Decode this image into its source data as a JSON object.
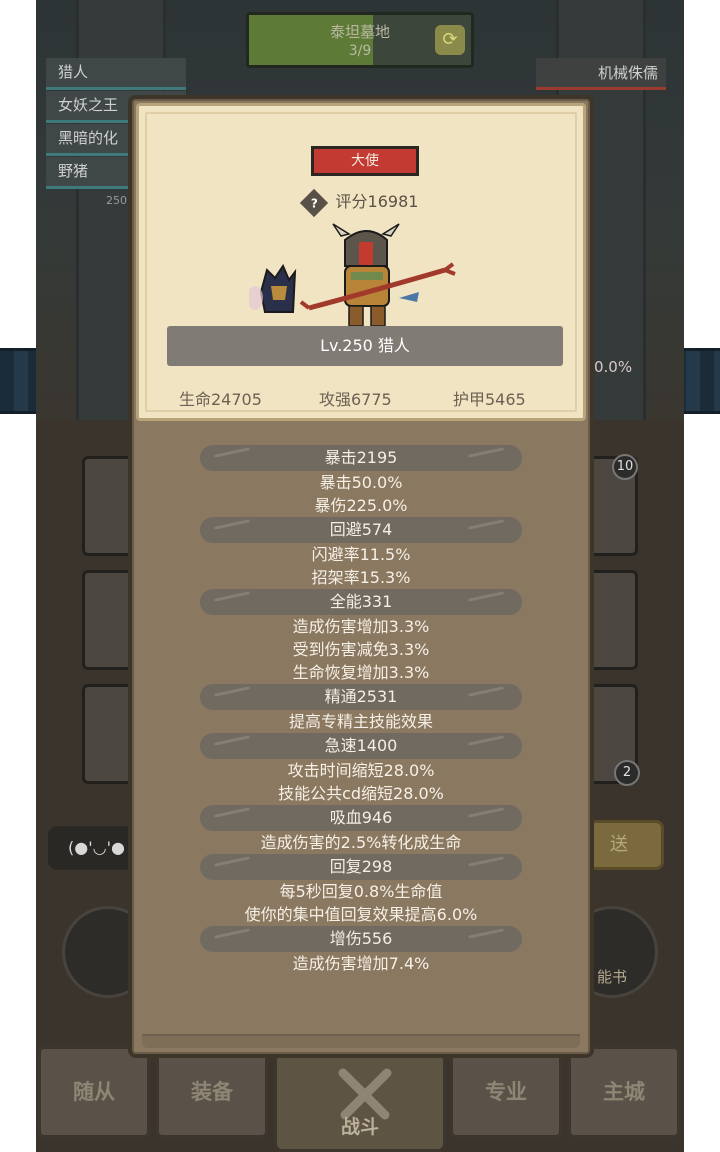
{
  "background": {
    "stage": {
      "title": "泰坦墓地",
      "count": "3/9",
      "progress": 0.56
    },
    "enemy_list": [
      "猎人",
      "女妖之王",
      "黑暗的化",
      "野猪"
    ],
    "boss_label": "机械侏儒",
    "small_number": "250",
    "percent_label": "0.0%",
    "slot_badges": [
      "10",
      "2"
    ],
    "chat_text": "(●'◡'●",
    "gold_button": "送",
    "skill_book_label": "能书",
    "nav": {
      "follower": "随从",
      "equipment": "装备",
      "battle": "战斗",
      "profession": "专业",
      "main_city": "主城"
    }
  },
  "panel": {
    "rank": "大使",
    "score": "评分16981",
    "name": "Lv.250 猎人",
    "hp": "生命24705",
    "attack": "攻强6775",
    "armor": "护甲5465"
  },
  "stats": [
    {
      "head": "暴击2195",
      "lines": [
        "暴击50.0%",
        "暴伤225.0%"
      ]
    },
    {
      "head": "回避574",
      "lines": [
        "闪避率11.5%",
        "招架率15.3%"
      ]
    },
    {
      "head": "全能331",
      "lines": [
        "造成伤害增加3.3%",
        "受到伤害减免3.3%",
        "生命恢复增加3.3%"
      ]
    },
    {
      "head": "精通2531",
      "lines": [
        "提高专精主技能效果"
      ]
    },
    {
      "head": "急速1400",
      "lines": [
        "攻击时间缩短28.0%",
        "技能公共cd缩短28.0%"
      ]
    },
    {
      "head": "吸血946",
      "lines": [
        "造成伤害的2.5%转化成生命"
      ]
    },
    {
      "head": "回复298",
      "lines": [
        "每5秒回复0.8%生命值",
        "使你的集中值回复效果提高6.0%"
      ]
    },
    {
      "head": "增伤556",
      "lines": [
        "造成伤害增加7.4%"
      ]
    }
  ]
}
